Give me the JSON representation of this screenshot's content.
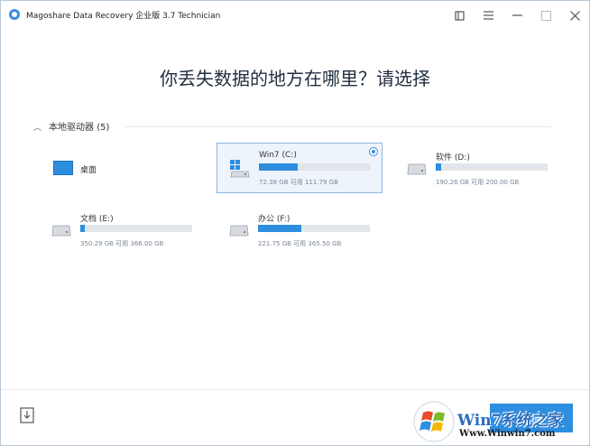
{
  "window": {
    "title": "Magoshare Data Recovery 企业版 3.7 Technician"
  },
  "main": {
    "headline": "你丢失数据的地方在哪里？请选择",
    "section_title": "本地驱动器 (5)"
  },
  "drives": [
    {
      "label": "桌面",
      "icon": "desktop-icon"
    },
    {
      "label": "Win7 (C:)",
      "size_text": "72.38 GB 可用 111.79 GB",
      "used_fraction": 0.35,
      "selected": true,
      "icon": "windows-drive-icon"
    },
    {
      "label": "软件 (D:)",
      "size_text": "190.26 GB 可用 200.00 GB",
      "used_fraction": 0.05,
      "icon": "drive-icon"
    },
    {
      "label": "文档 (E:)",
      "size_text": "350.29 GB 可用 366.00 GB",
      "used_fraction": 0.04,
      "icon": "drive-icon"
    },
    {
      "label": "办公 (F:)",
      "size_text": "221.75 GB 可用 365.50 GB",
      "used_fraction": 0.39,
      "icon": "drive-icon"
    }
  ],
  "footer": {
    "scan_label": "扫描"
  },
  "watermark": {
    "brand": "Win7系统之家",
    "url": "Www.Winwin7.com"
  },
  "colors": {
    "accent": "#2d8ee0",
    "selected_bg": "#eef4fb",
    "track": "#e2e5e9"
  }
}
